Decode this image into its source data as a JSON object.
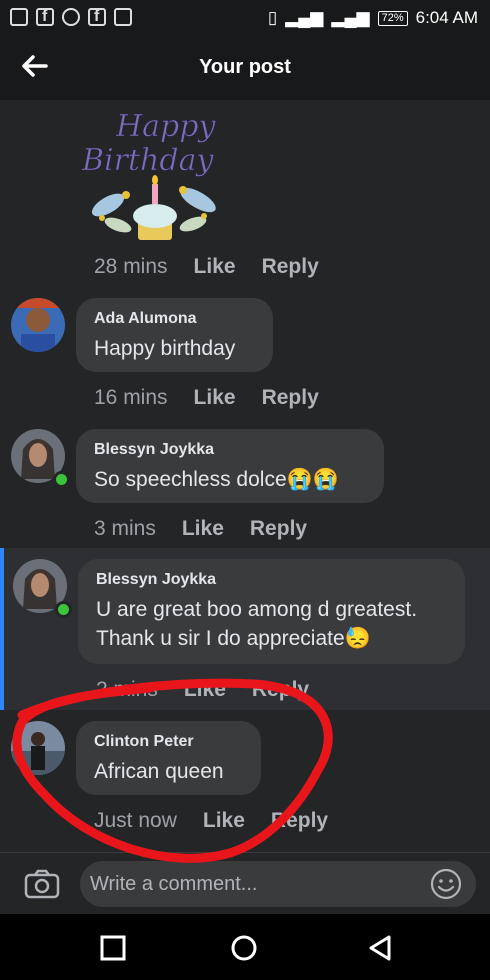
{
  "status_bar": {
    "time": "6:04 AM",
    "battery": "72%"
  },
  "header": {
    "title": "Your post"
  },
  "sticker": {
    "text_line1": "Happy",
    "text_line2": "Birthday"
  },
  "comments": [
    {
      "name": "",
      "text": "",
      "time": "28 mins",
      "like": "Like",
      "reply": "Reply"
    },
    {
      "name": "Ada Alumona",
      "text": "Happy birthday",
      "time": "16 mins",
      "like": "Like",
      "reply": "Reply"
    },
    {
      "name": "Blessyn Joykka",
      "text": "So speechless dolce😭😭",
      "time": "3 mins",
      "like": "Like",
      "reply": "Reply"
    },
    {
      "name": "Blessyn Joykka",
      "text_line1": "U are great boo among d greatest.",
      "text_line2": "Thank u sir I do appreciate😓",
      "time": "2 mins",
      "like": "Like",
      "reply": "Reply"
    },
    {
      "name": "Clinton Peter",
      "text": "African queen",
      "time": "Just now",
      "like": "Like",
      "reply": "Reply"
    }
  ],
  "composer": {
    "placeholder": "Write a comment..."
  },
  "colors": {
    "online": "#3bc43b",
    "highlight_bar": "#2d88ff",
    "annotation": "#e8161b"
  }
}
